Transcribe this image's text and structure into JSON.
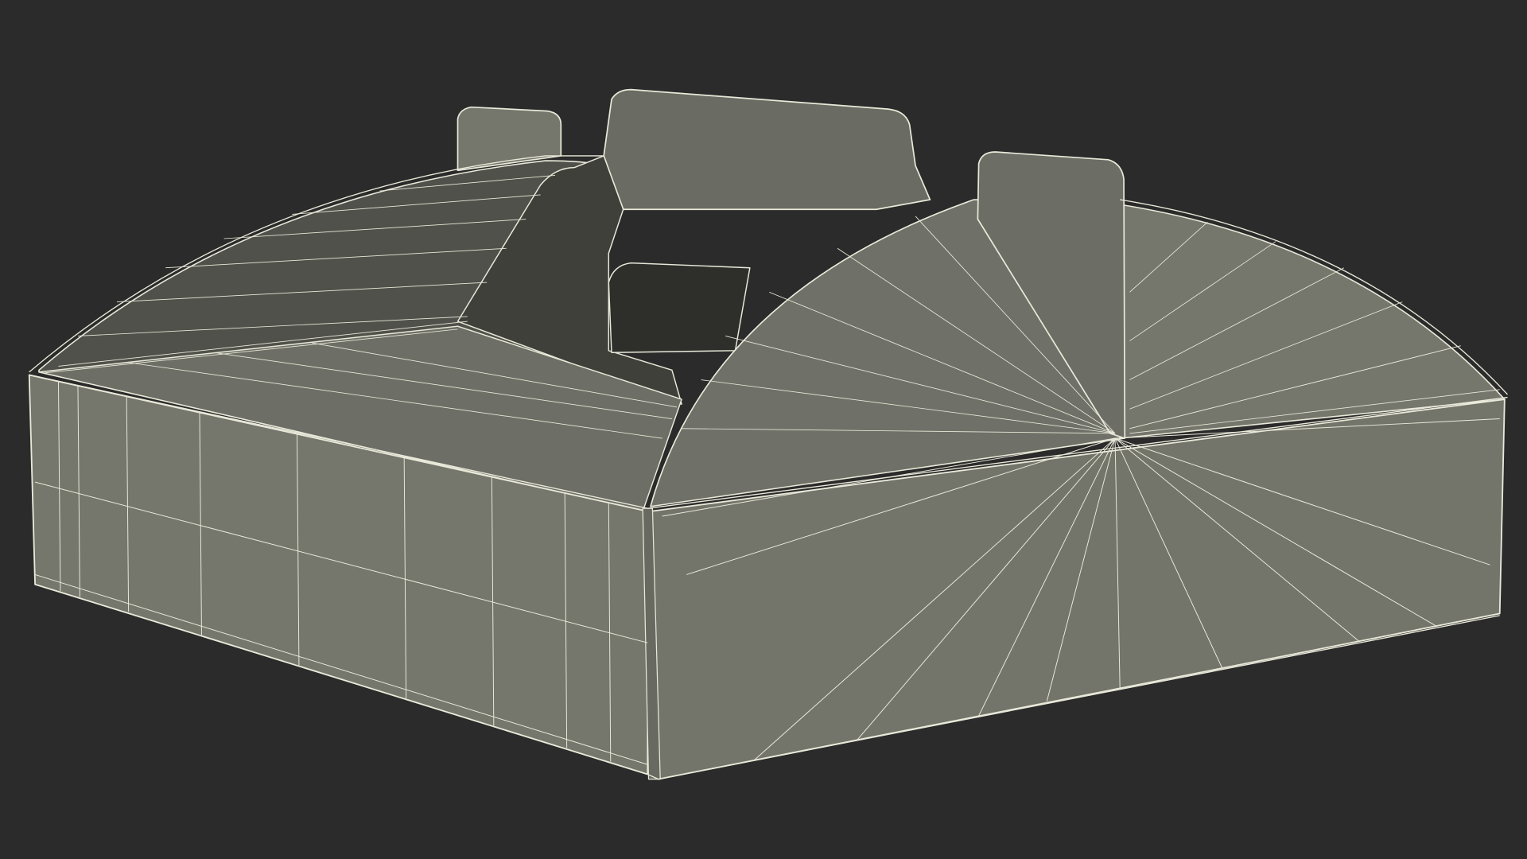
{
  "viewport": {
    "background_color": "#2b2b2b",
    "subject": "wireframe-render",
    "surface_color": "#75766c",
    "surface_shadow_color": "#4e4f47",
    "surface_dark_color": "#3d3e38",
    "wire_color": "#e9e9da"
  }
}
